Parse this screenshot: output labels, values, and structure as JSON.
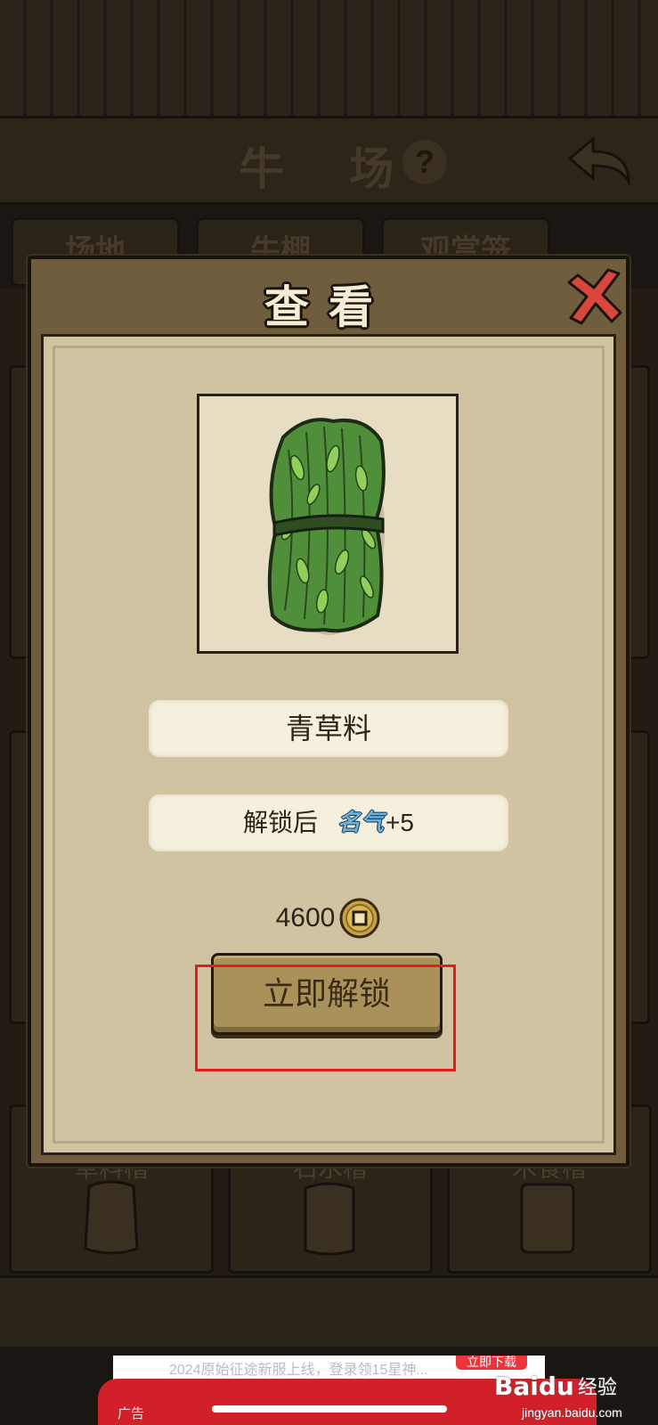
{
  "background": {
    "screen_title": "牛 场",
    "help_label": "?",
    "tabs": [
      "场地",
      "牛棚",
      "观赏笼"
    ],
    "card_labels": [
      "草料槽",
      "石水槽",
      "木食槽"
    ]
  },
  "dialog": {
    "title": "查看",
    "item": {
      "name": "青草料",
      "image_icon": "grass-bundle-icon"
    },
    "effect": {
      "label": "解锁后",
      "stat_name": "名气",
      "value": "+5"
    },
    "price": {
      "amount": "4600",
      "currency_icon": "copper-coin-icon"
    },
    "unlock_button_label": "立即解锁",
    "highlight_color": "#e11d1d"
  },
  "ad": {
    "text": "2024原始征途新服上线，登录领15星神...",
    "download_label": "立即下载",
    "badge": "广告"
  },
  "watermark": {
    "brand": "Baidu",
    "sub": "经验",
    "url": "jingyan.baidu.com"
  }
}
